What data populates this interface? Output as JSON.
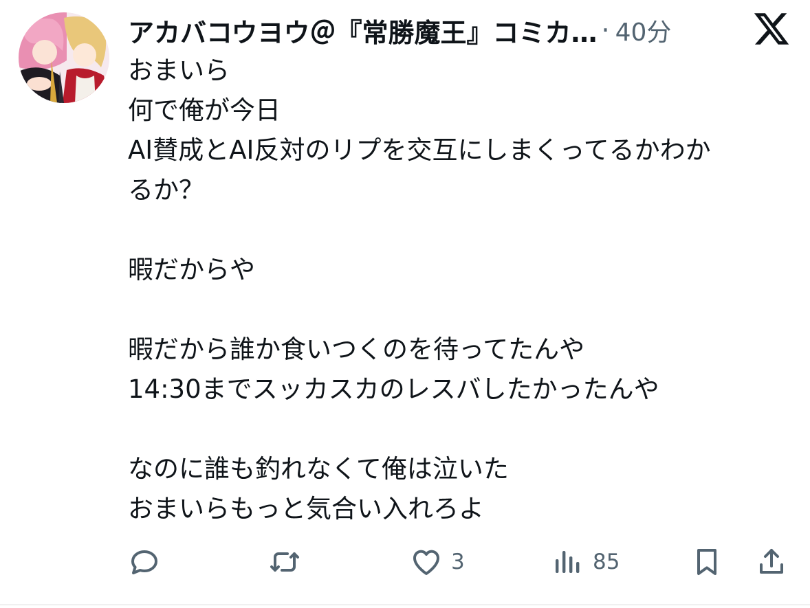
{
  "tweet": {
    "author": {
      "display_name": "アカバコウヨウ＠『常勝魔王』コミカ…",
      "avatar": "avatar-illustration"
    },
    "separator": "·",
    "timestamp": "40分",
    "platform_icon": "x-logo-icon",
    "body_lines": [
      "おまいら",
      "何で俺が今日",
      "AI賛成とAI反対のリプを交互にしまくってるかわか",
      "るか？",
      "",
      "暇だからや",
      "",
      "暇だから誰か食いつくのを待ってたんや",
      "14:30までスッカスカのレスバしたかったんや",
      "",
      "なのに誰も釣れなくて俺は泣いた",
      "おまいらもっと気合い入れろよ"
    ],
    "actions": {
      "reply": {
        "icon": "reply-icon",
        "count": ""
      },
      "retweet": {
        "icon": "retweet-icon",
        "count": ""
      },
      "like": {
        "icon": "heart-icon",
        "count": "3"
      },
      "views": {
        "icon": "views-icon",
        "count": "85"
      },
      "bookmark": {
        "icon": "bookmark-icon"
      },
      "share": {
        "icon": "share-icon"
      }
    },
    "colors": {
      "text": "#0f1419",
      "secondary": "#536471"
    }
  }
}
